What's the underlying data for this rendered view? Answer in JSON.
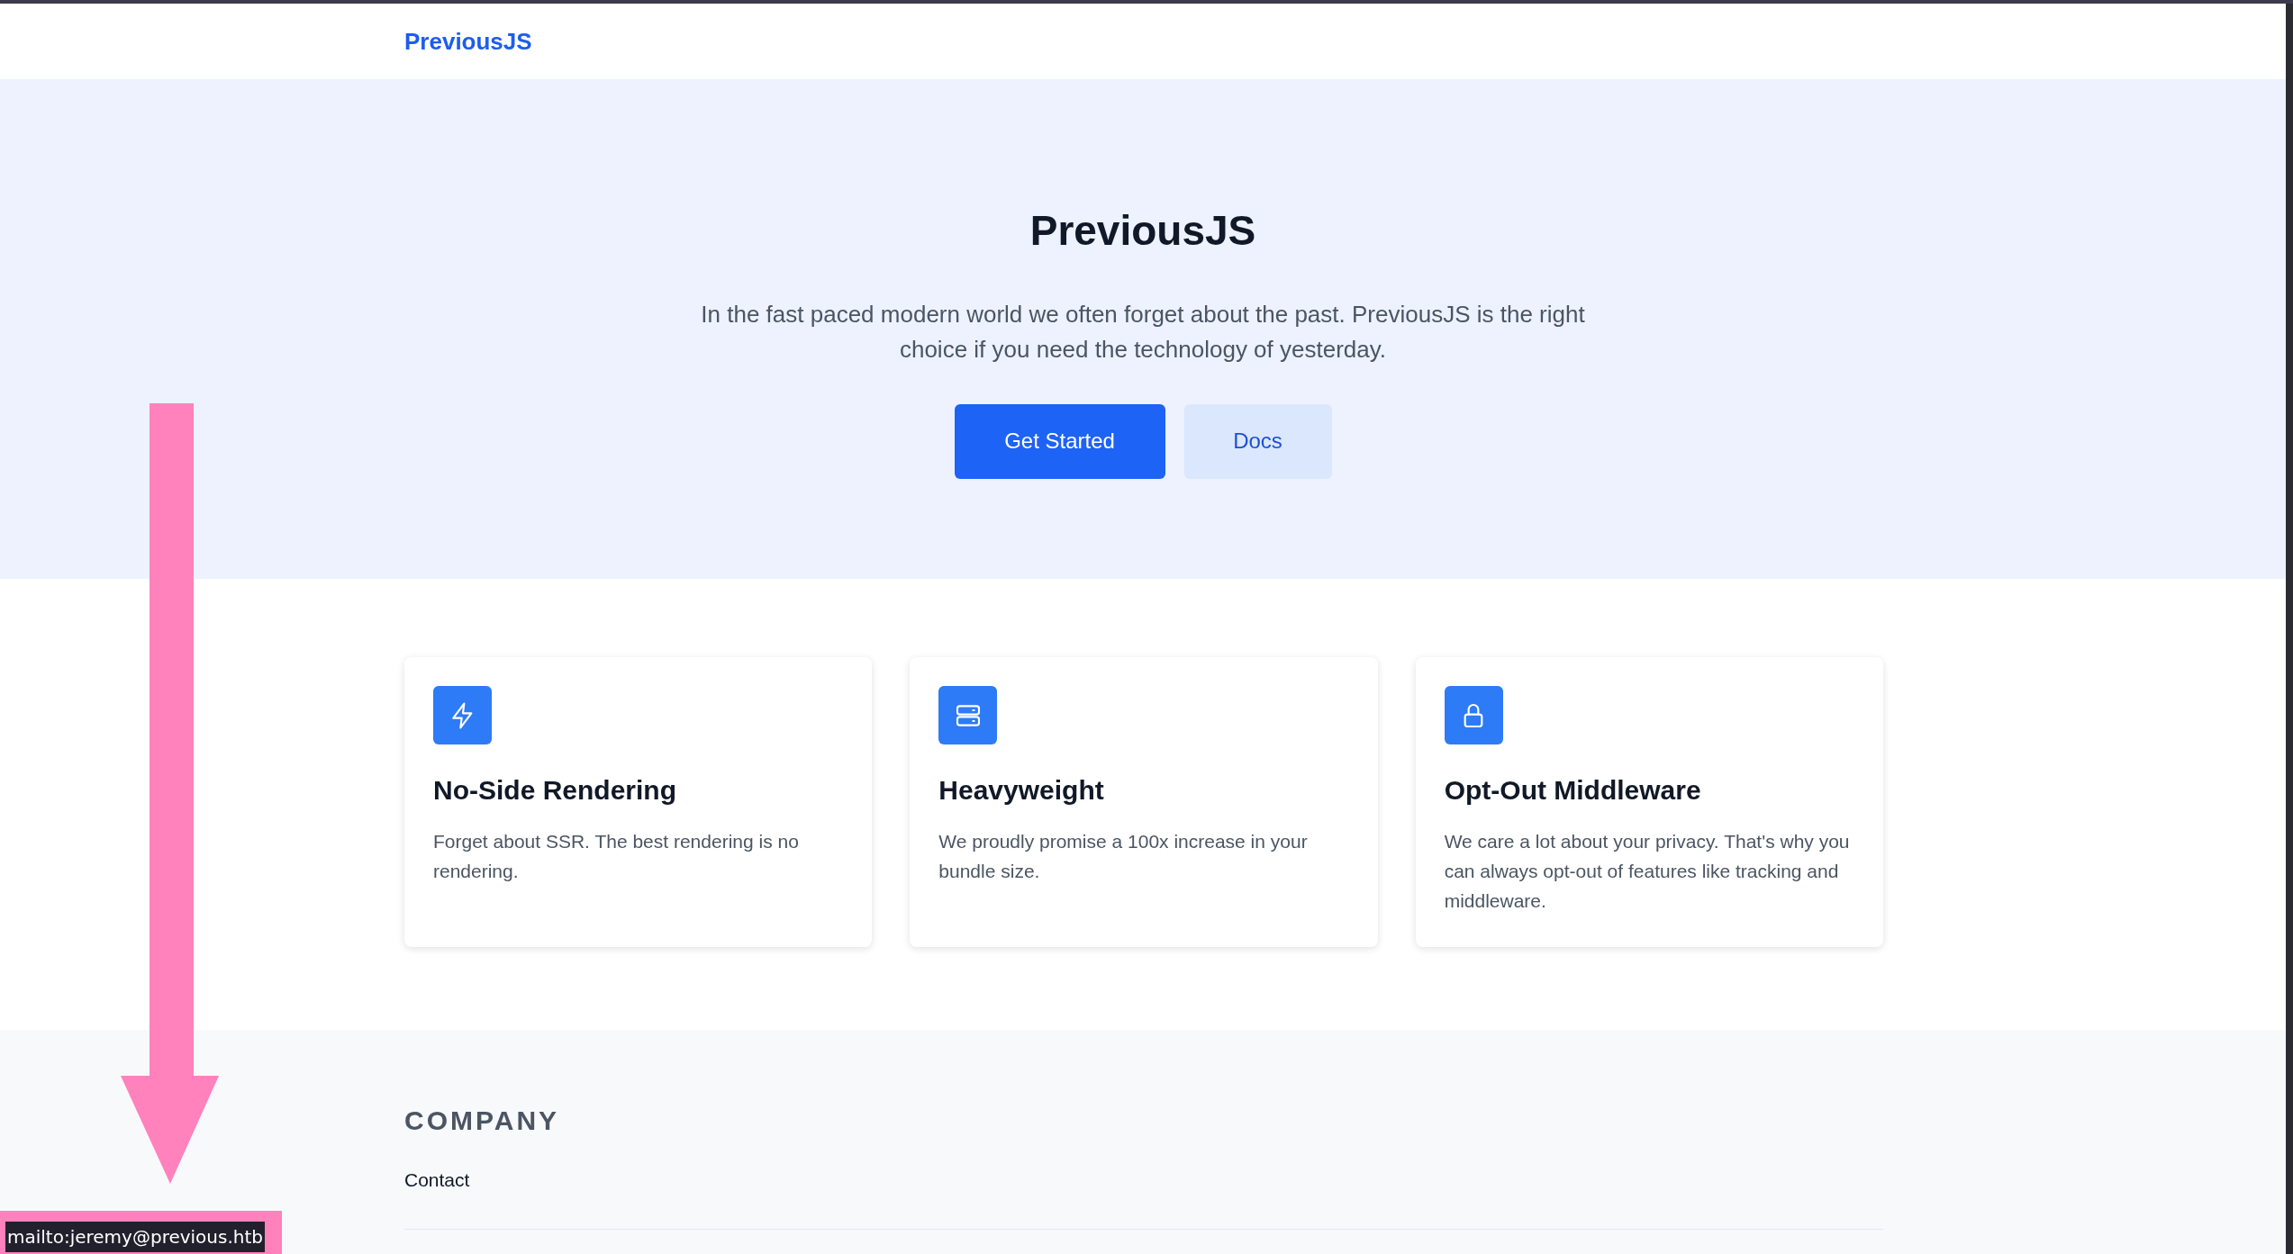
{
  "navbar": {
    "logo": "PreviousJS"
  },
  "hero": {
    "title": "PreviousJS",
    "subtitle": "In the fast paced modern world we often forget about the past. PreviousJS is the right choice if you need the technology of yesterday.",
    "buttons": [
      {
        "label": "Get Started",
        "kind": "primary"
      },
      {
        "label": "Docs",
        "kind": "secondary"
      }
    ]
  },
  "features": [
    {
      "kind": "bolt",
      "title": "No-Side Rendering",
      "description": "Forget about SSR. The best rendering is no rendering."
    },
    {
      "kind": "server",
      "title": "Heavyweight",
      "description": "We proudly promise a 100x increase in your bundle size."
    },
    {
      "kind": "lock",
      "title": "Opt-Out Middleware",
      "description": "We care a lot about your privacy. That's why you can always opt-out of features like tracking and middleware."
    }
  ],
  "footer": {
    "heading": "COMPANY",
    "links": [
      "Contact"
    ]
  },
  "status_bar": {
    "text": "mailto:jeremy@previous.htb"
  }
}
